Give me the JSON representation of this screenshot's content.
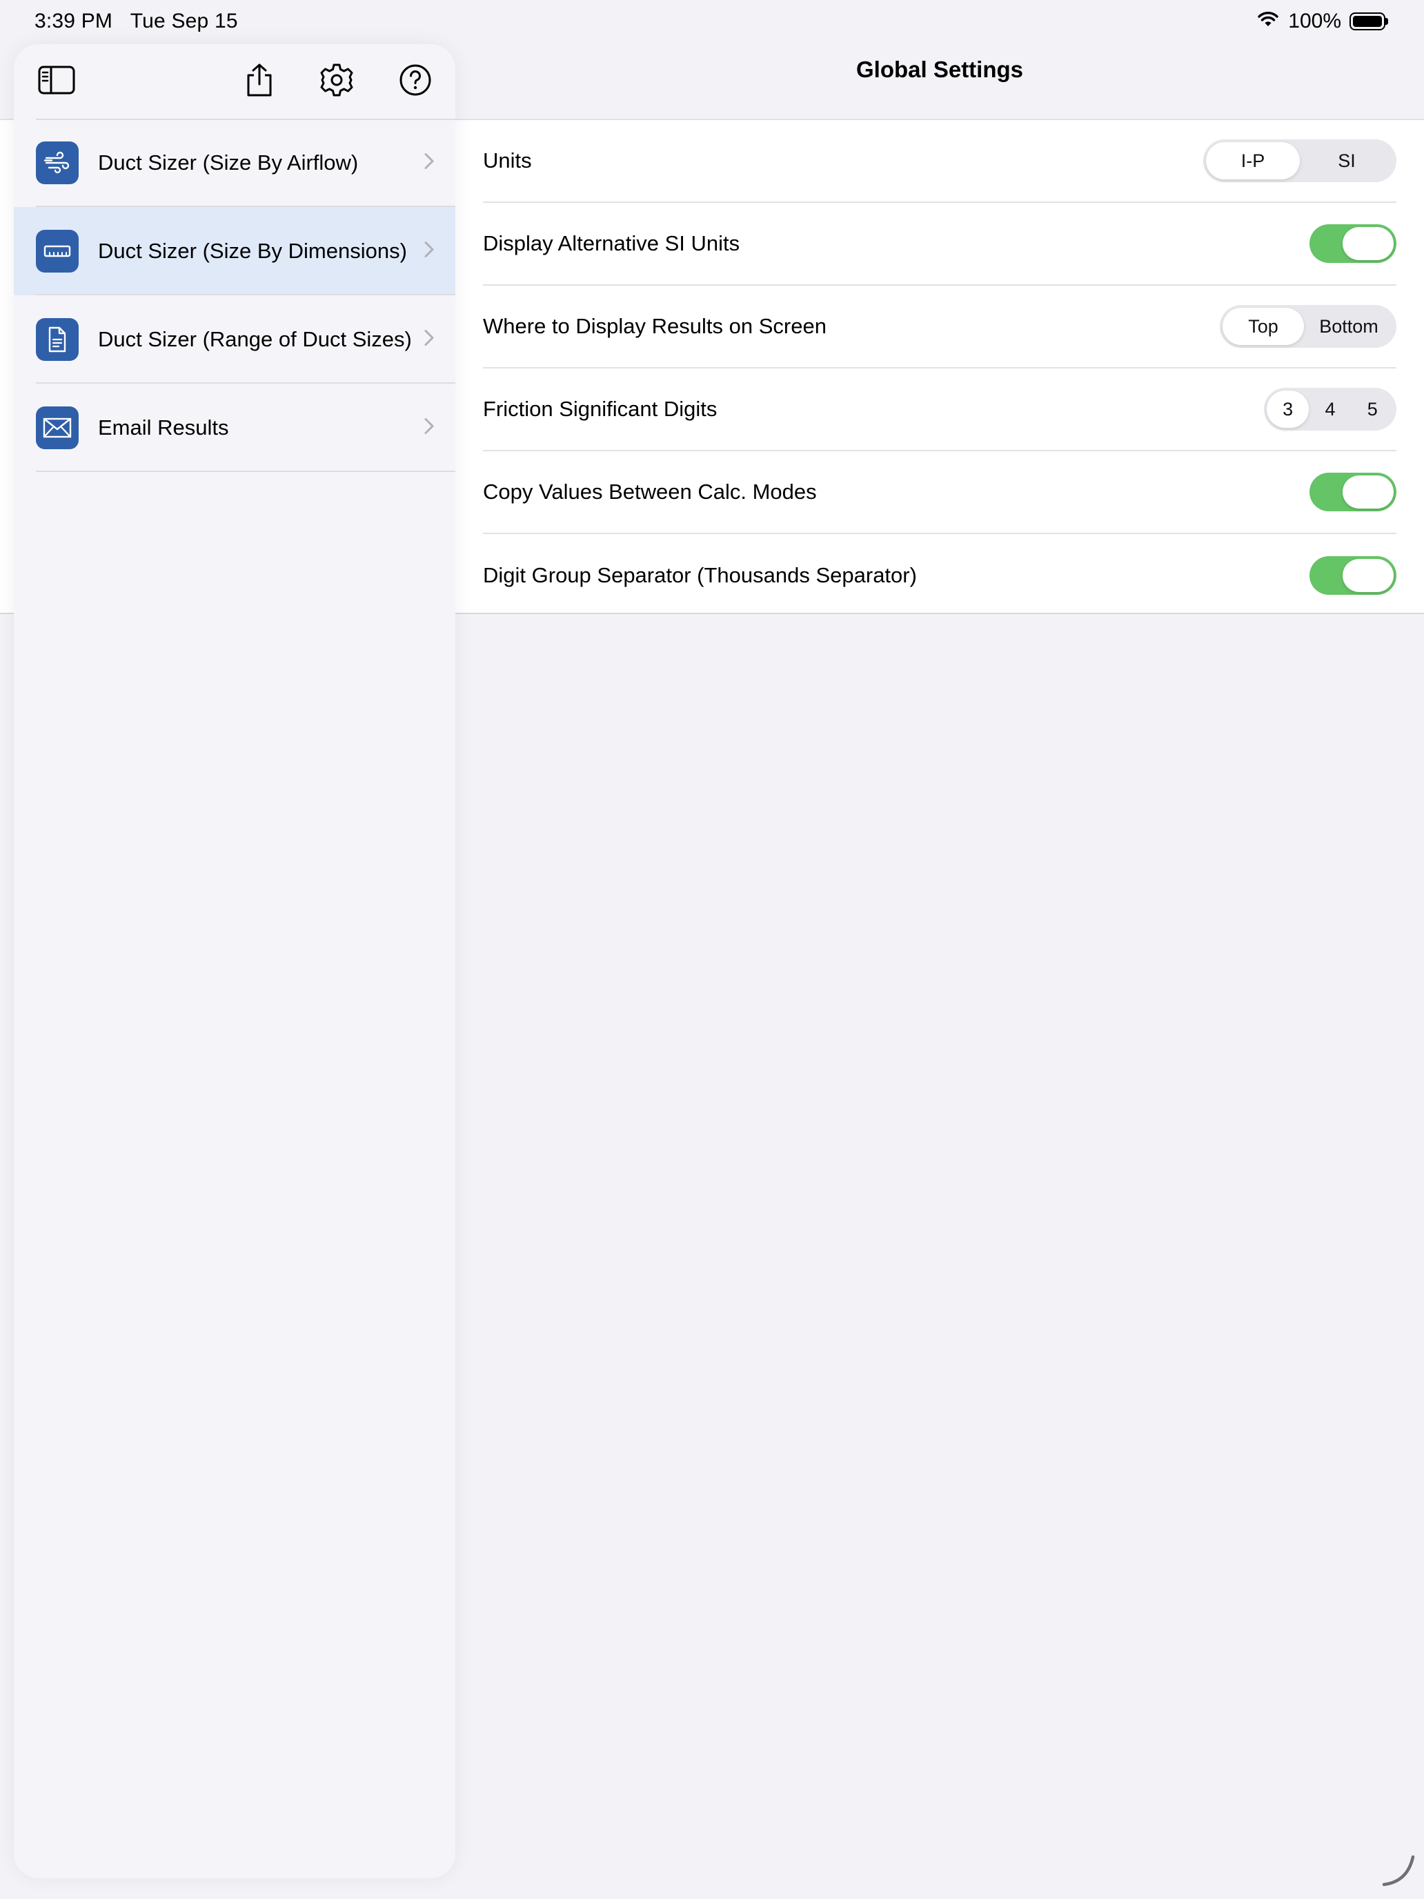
{
  "status_bar": {
    "time": "3:39 PM",
    "date": "Tue Sep 15",
    "battery": "100%",
    "wifi_icon": "wifi-icon",
    "battery_icon": "battery-icon"
  },
  "sidebar": {
    "toolbar": {
      "sidebar_toggle_icon": "sidebar-toggle-icon",
      "share_icon": "share-icon",
      "settings_icon": "gear-icon",
      "help_icon": "help-icon"
    },
    "items": [
      {
        "label": "Duct Sizer (Size By Airflow)",
        "icon": "wind-icon",
        "selected": false
      },
      {
        "label": "Duct Sizer (Size By Dimensions)",
        "icon": "ruler-icon",
        "selected": true
      },
      {
        "label": "Duct Sizer (Range of Duct Sizes)",
        "icon": "document-icon",
        "selected": false
      },
      {
        "label": "Email Results",
        "icon": "envelope-icon",
        "selected": false
      }
    ]
  },
  "detail": {
    "title": "Global Settings",
    "rows": [
      {
        "label": "Units",
        "control": "segmented",
        "options": [
          "I-P",
          "SI"
        ],
        "selected": "I-P"
      },
      {
        "label": "Display Alternative SI Units",
        "control": "toggle",
        "on": true
      },
      {
        "label": "Where to Display Results on Screen",
        "control": "segmented",
        "options": [
          "Top",
          "Bottom"
        ],
        "selected": "Top"
      },
      {
        "label": "Friction Significant Digits",
        "control": "segmented",
        "options": [
          "3",
          "4",
          "5"
        ],
        "selected": "3"
      },
      {
        "label": "Copy Values Between Calc. Modes",
        "control": "toggle",
        "on": true
      },
      {
        "label": "Digit Group Separator (Thousands Separator)",
        "control": "toggle",
        "on": true
      }
    ]
  },
  "colors": {
    "accent_icon_bg": "#2f5fa8",
    "toggle_on": "#65c466",
    "selected_row": "#dfe9f8"
  }
}
